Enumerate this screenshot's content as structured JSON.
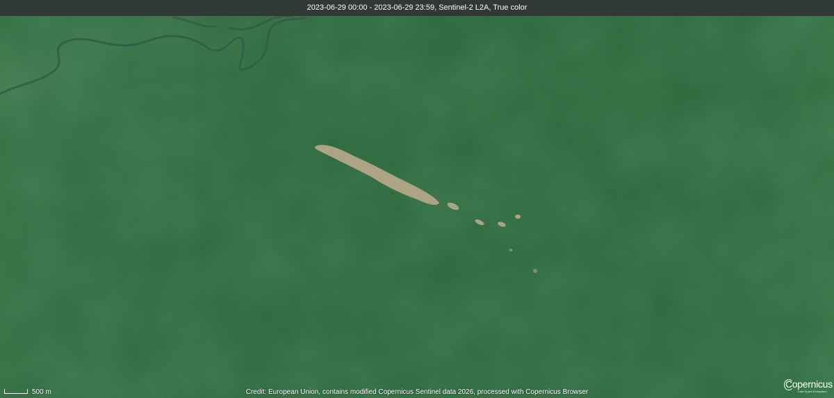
{
  "header": {
    "title": "2023-06-29 00:00 - 2023-06-29 23:59, Sentinel-2 L2A, True color"
  },
  "footer": {
    "credit": "Credit: European Union, contains modified Copernicus Sentinel data 2026, processed with Copernicus Browser"
  },
  "scale": {
    "label": "500 m"
  },
  "logo": {
    "text": "Copernicus",
    "subtitle": "Data Space Ecosystem"
  },
  "colors": {
    "forest": "#245f34",
    "clearing": "#b9aa8c",
    "river": "#3d6a55"
  }
}
